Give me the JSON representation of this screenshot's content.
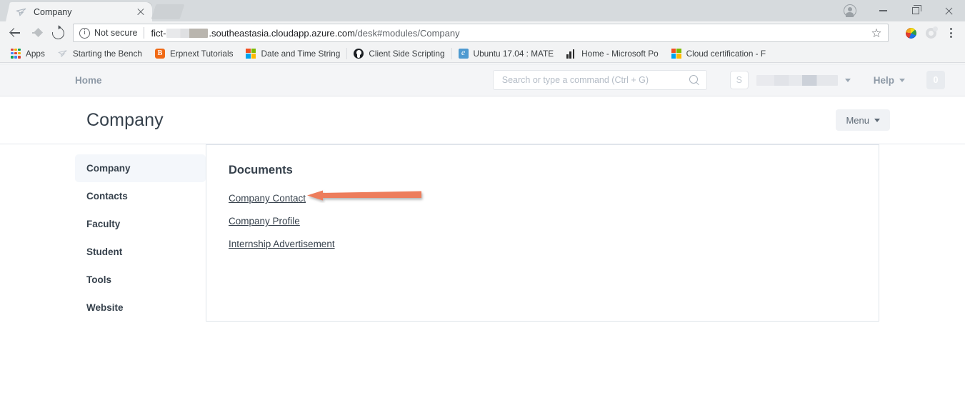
{
  "browser": {
    "tab": {
      "title": "Company",
      "favicon": "frappe-plane-icon",
      "close_label": "×"
    },
    "newtab_label": "",
    "window_controls": {
      "profile": "profile-avatar-icon",
      "minimize": "minimize-icon",
      "maximize": "maximize-icon",
      "close": "close-icon"
    },
    "omnibox": {
      "security_label": "Not secure",
      "url_prefix": "fict-",
      "url_redacted": "",
      "url_domain": ".southeastasia.cloudapp.azure.com",
      "url_path": "/desk#modules/Company",
      "bookmark_star": "☆"
    },
    "bookmarks": [
      {
        "label": "Apps",
        "icon": "apps-grid-icon"
      },
      {
        "label": "Starting the Bench",
        "icon": "frappe-plane-icon"
      },
      {
        "label": "Erpnext Tutorials",
        "icon": "blogger-icon"
      },
      {
        "label": "Date and Time String",
        "icon": "microsoft-tile-icon"
      },
      {
        "label": "Client Side Scripting",
        "icon": "github-icon"
      },
      {
        "label": "Ubuntu 17.04 : MATE",
        "icon": "ie-browser-icon"
      },
      {
        "label": "Home - Microsoft Po",
        "icon": "powerbi-bars-icon"
      },
      {
        "label": "Cloud certification - F",
        "icon": "microsoft-tile-icon"
      }
    ]
  },
  "app": {
    "navbar": {
      "home_label": "Home",
      "search_placeholder": "Search or type a command (Ctrl + G)",
      "search_value": "",
      "avatar_initial": "S",
      "username_redacted": "",
      "help_label": "Help",
      "notification_count": "0"
    },
    "page": {
      "title": "Company",
      "menu_label": "Menu"
    },
    "sidebar": {
      "items": [
        {
          "label": "Company",
          "active": true
        },
        {
          "label": "Contacts",
          "active": false
        },
        {
          "label": "Faculty",
          "active": false
        },
        {
          "label": "Student",
          "active": false
        },
        {
          "label": "Tools",
          "active": false
        },
        {
          "label": "Website",
          "active": false
        }
      ]
    },
    "content": {
      "section_title": "Documents",
      "documents": [
        {
          "label": "Company Contact"
        },
        {
          "label": "Company Profile"
        },
        {
          "label": "Internship Advertisement"
        }
      ]
    }
  },
  "annotation": {
    "type": "arrow-left",
    "points_to": "Company Contact",
    "color": "#ED7D5C"
  }
}
